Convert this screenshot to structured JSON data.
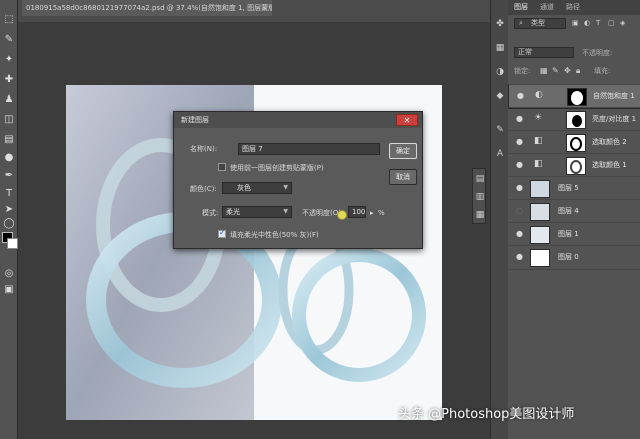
{
  "document": {
    "tab_title": "0180915a58d0c8680121977074a2.psd @ 37.4%(自然饱和度 1, 图层蒙版/8)",
    "close_glyph": "×"
  },
  "toolbar": {
    "tools": [
      "rect-marquee-icon",
      "lasso-icon",
      "brush-icon",
      "healing-icon",
      "clone-stamp-icon",
      "eraser-icon",
      "gradient-icon",
      "dodge-icon",
      "pen-icon",
      "type-icon",
      "path-select-icon",
      "ellipse-icon",
      "zoom-icon"
    ],
    "glyphs": [
      "⬚",
      "✎",
      "✦",
      "✚",
      "♟",
      "◫",
      "▤",
      "●",
      "✒",
      "T",
      "➤",
      "◯",
      "⌕"
    ]
  },
  "dialog": {
    "title": "新建图层",
    "close": "✕",
    "name_label": "名称(N):",
    "name_value": "图层 7",
    "clip_label": "使用前一图层创建剪贴蒙版(P)",
    "color_label": "颜色(C):",
    "color_value": "灰色",
    "mode_label": "模式:",
    "mode_value": "柔光",
    "opacity_label": "不透明度(O):",
    "opacity_value": "100",
    "opacity_unit": "%",
    "fill_label": "填充柔光中性色(50% 灰)(F)",
    "fill_checked": true,
    "ok": "确定",
    "cancel": "取消"
  },
  "panel": {
    "tabs": [
      "图层",
      "通道",
      "路径"
    ],
    "kind": "类型",
    "blend": "正常",
    "opacity_label": "不透明度:",
    "fill_label": "填充:",
    "lock_label": "锁定:",
    "layers": [
      {
        "name": "自然饱和度 1",
        "adj_icon": "◐",
        "selected": true,
        "visible": true
      },
      {
        "name": "亮度/对比度 1",
        "adj_icon": "☀",
        "selected": false,
        "visible": true
      },
      {
        "name": "选取颜色 2",
        "adj_icon": "◧",
        "selected": false,
        "visible": true
      },
      {
        "name": "选取颜色 1",
        "adj_icon": "◧",
        "selected": false,
        "visible": true
      },
      {
        "name": "图层 5",
        "adj_icon": "",
        "selected": false,
        "visible": true
      },
      {
        "name": "图层 4",
        "adj_icon": "",
        "selected": false,
        "visible": false
      },
      {
        "name": "图层 1",
        "adj_icon": "",
        "selected": false,
        "visible": true
      },
      {
        "name": "图层 0",
        "adj_icon": "",
        "selected": false,
        "visible": true
      }
    ]
  },
  "watermark": "头条 @Photoshop美图设计师",
  "colors": {
    "accent_close": "#c8423a",
    "panel_bg": "#535353",
    "workspace": "#3c3c3c"
  }
}
